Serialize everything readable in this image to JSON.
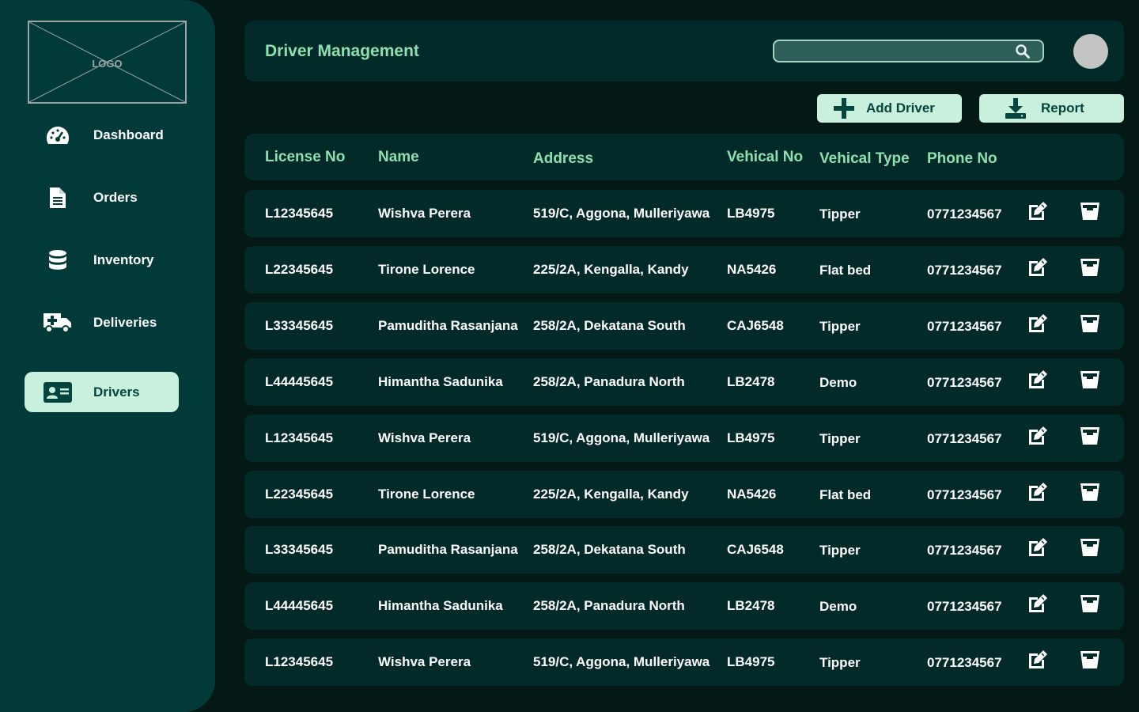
{
  "sidebar": {
    "logo_text": "LOGO",
    "items": [
      {
        "label": "Dashboard",
        "icon": "gauge-icon",
        "active": false
      },
      {
        "label": "Orders",
        "icon": "document-icon",
        "active": false
      },
      {
        "label": "Inventory",
        "icon": "database-icon",
        "active": false
      },
      {
        "label": "Deliveries",
        "icon": "ambulance-truck-icon",
        "active": false
      },
      {
        "label": "Drivers",
        "icon": "id-card-icon",
        "active": true
      }
    ]
  },
  "header": {
    "title": "Driver Management",
    "search": {
      "value": "",
      "placeholder": ""
    }
  },
  "actions": {
    "add_label": "Add Driver",
    "report_label": "Report"
  },
  "table": {
    "columns": [
      "License No",
      "Name",
      "Address",
      "Vehical No",
      "Vehical Type",
      "Phone No"
    ],
    "rows": [
      {
        "license": "L12345645",
        "name": "Wishva Perera",
        "address": "519/C, Aggona, Mulleriyawa",
        "vehicle_no": "LB4975",
        "vehicle_type": "Tipper",
        "phone": "0771234567"
      },
      {
        "license": "L22345645",
        "name": "Tirone Lorence",
        "address": "225/2A, Kengalla, Kandy",
        "vehicle_no": "NA5426",
        "vehicle_type": "Flat bed",
        "phone": "0771234567"
      },
      {
        "license": "L33345645",
        "name": "Pamuditha Rasanjana",
        "address": "258/2A, Dekatana South",
        "vehicle_no": "CAJ6548",
        "vehicle_type": "Tipper",
        "phone": "0771234567"
      },
      {
        "license": "L44445645",
        "name": "Himantha Sadunika",
        "address": "258/2A, Panadura North",
        "vehicle_no": "LB2478",
        "vehicle_type": "Demo",
        "phone": "0771234567"
      },
      {
        "license": "L12345645",
        "name": "Wishva Perera",
        "address": "519/C, Aggona, Mulleriyawa",
        "vehicle_no": "LB4975",
        "vehicle_type": "Tipper",
        "phone": "0771234567"
      },
      {
        "license": "L22345645",
        "name": "Tirone Lorence",
        "address": "225/2A, Kengalla, Kandy",
        "vehicle_no": "NA5426",
        "vehicle_type": "Flat bed",
        "phone": "0771234567"
      },
      {
        "license": "L33345645",
        "name": "Pamuditha Rasanjana",
        "address": "258/2A, Dekatana South",
        "vehicle_no": "CAJ6548",
        "vehicle_type": "Tipper",
        "phone": "0771234567"
      },
      {
        "license": "L44445645",
        "name": "Himantha Sadunika",
        "address": "258/2A, Panadura North",
        "vehicle_no": "LB2478",
        "vehicle_type": "Demo",
        "phone": "0771234567"
      },
      {
        "license": "L12345645",
        "name": "Wishva Perera",
        "address": "519/C, Aggona, Mulleriyawa",
        "vehicle_no": "LB4975",
        "vehicle_type": "Tipper",
        "phone": "0771234567"
      }
    ],
    "row_actions": {
      "edit_icon": "edit-icon",
      "delete_icon": "trash-icon"
    }
  },
  "colors": {
    "background": "#041816",
    "sidebar": "#023a3a",
    "panel": "#022a28",
    "accent_text": "#8ee0b0",
    "active_bg": "#c8f0dc",
    "active_text": "#04453f"
  }
}
